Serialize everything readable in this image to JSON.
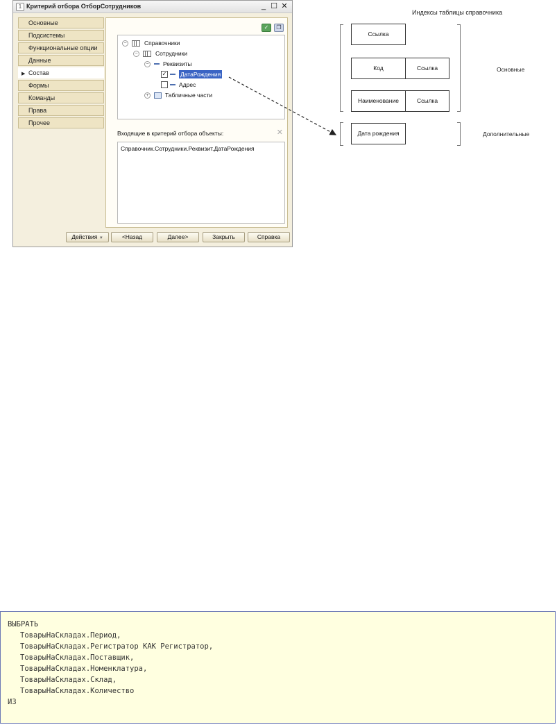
{
  "window": {
    "title": "Критерий отбора ОтборСотрудников",
    "icon": "1c-logo-icon"
  },
  "sidebar": {
    "items": [
      {
        "label": "Основные",
        "active": false
      },
      {
        "label": "Подсистемы",
        "active": false
      },
      {
        "label": "Функциональные опции",
        "active": false
      },
      {
        "label": "Данные",
        "active": false
      },
      {
        "label": "Состав",
        "active": true
      },
      {
        "label": "Формы",
        "active": false
      },
      {
        "label": "Команды",
        "active": false
      },
      {
        "label": "Права",
        "active": false
      },
      {
        "label": "Прочее",
        "active": false
      }
    ]
  },
  "tree": {
    "n0": "Справочники",
    "n1": "Сотрудники",
    "n2": "Реквизиты",
    "n3": "ДатаРождения",
    "n4": "Адрес",
    "n5": "Табличные части"
  },
  "included": {
    "label": "Входящие в критерий отбора объекты:",
    "value": "Справочник.Сотрудники.Реквизит.ДатаРождения"
  },
  "buttons": {
    "actions": "Действия",
    "back": "<Назад",
    "next": "Далее>",
    "close": "Закрыть",
    "help": "Справка"
  },
  "diagram": {
    "title": "Индексы таблицы справочника",
    "box_link_1": "Ссылка",
    "box_code": "Код",
    "box_link_2": "Ссылка",
    "box_name": "Наименование",
    "box_link_3": "Ссылка",
    "box_birthdate": "Дата рождения",
    "label_main": "Основные",
    "label_additional": "Дополнительные"
  },
  "code": {
    "lines": [
      "ВЫБРАТЬ",
      "ТоварыНаСкладах.Период,",
      "ТоварыНаСкладах.Регистратор КАК Регистратор,",
      "ТоварыНаСкладах.Поставщик,",
      "ТоварыНаСкладах.Номенклатура,",
      "ТоварыНаСкладах.Склад,",
      "ТоварыНаСкладах.Количество",
      "ИЗ"
    ]
  },
  "colors": {
    "selection": "#3a64c4",
    "window_bg": "#f4efde",
    "code_bg": "#ffffe0"
  }
}
